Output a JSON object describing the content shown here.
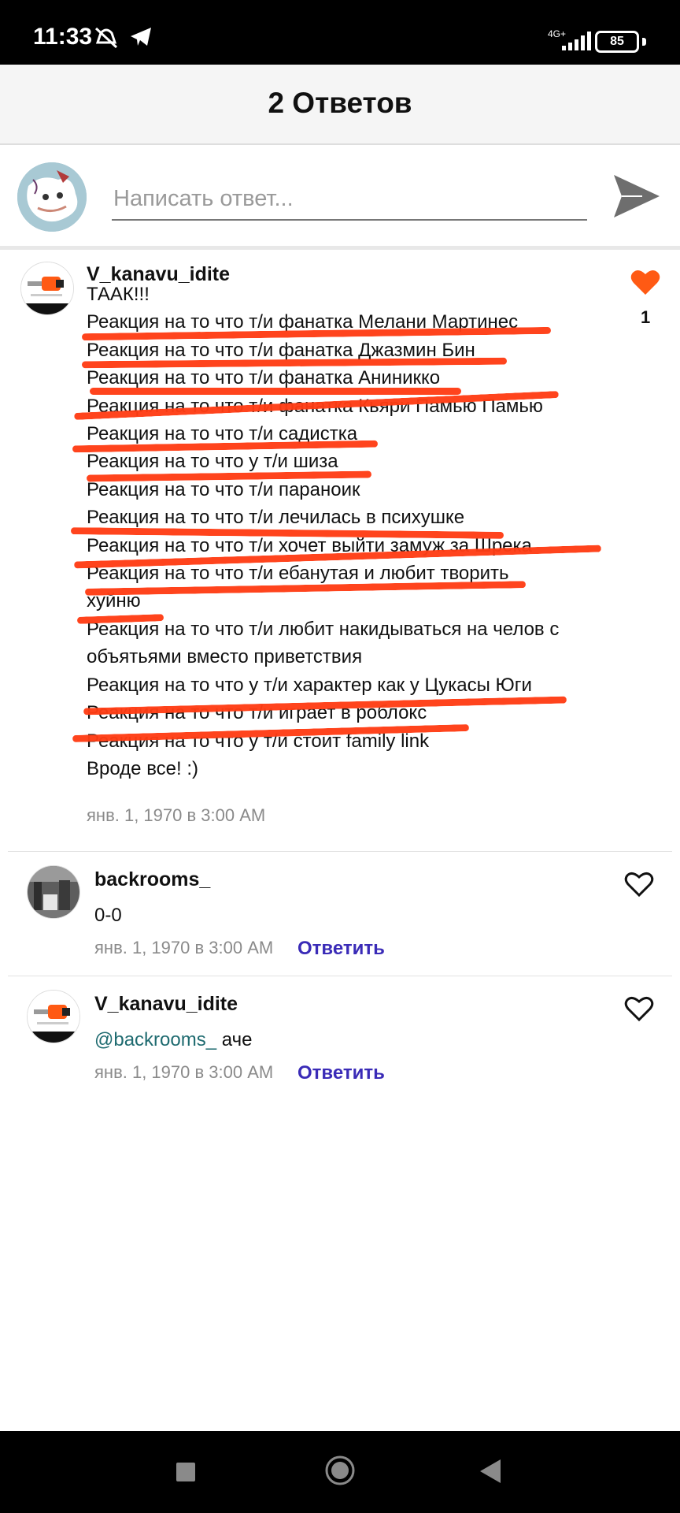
{
  "status_bar": {
    "time": "11:33",
    "network": "4G+",
    "battery": "85"
  },
  "header": {
    "title": "2 Ответов"
  },
  "compose": {
    "placeholder": "Написать ответ..."
  },
  "accent_color": "#ff5a14",
  "strike_color": "#ff3d14",
  "link_color": "#3a2bb7",
  "main_comment": {
    "username": "V_kanavu_idite",
    "lines": [
      "ТААК!!!",
      "Реакция на то что т/и фанатка Мелани Мартинес",
      "Реакция на то что т/и фанатка Джазмин Бин",
      "Реакция на то что т/и фанатка Аниникко",
      "Реакция на то что т/и фанатка Кьяри Памью Памью",
      "Реакция на то что т/и садистка",
      "Реакция на то что у т/и шиза",
      "Реакция на то что т/и параноик",
      "Реакция на то что т/и лечилась в психушке",
      "Реакция на то что т/и хочет выйти замуж за Шрека",
      "Реакция на то что т/и ебанутая и любит творить хуйню",
      "Реакция на то что т/и любит накидываться на челов с объятьями вместо приветствия",
      "Реакция на то что у т/и характер как у Цукасы Юги",
      "Реакция на то что т/и играет в роблокс",
      "Реакция на то что у т/и стоит family link",
      "Вроде все! :)"
    ],
    "date": "янв. 1, 1970 в 3:00 AM",
    "likes": "1",
    "liked": true
  },
  "replies": [
    {
      "username": "backrooms_",
      "text": "0-0",
      "date": "янв. 1, 1970 в 3:00 AM",
      "reply_label": "Ответить",
      "liked": false
    },
    {
      "username": "V_kanavu_idite",
      "mention": "@backrooms_",
      "text": "аче",
      "date": "янв. 1, 1970 в 3:00 AM",
      "reply_label": "Ответить",
      "liked": false
    }
  ],
  "nav": {
    "buttons": [
      "recents-button",
      "home-button",
      "back-button"
    ]
  }
}
